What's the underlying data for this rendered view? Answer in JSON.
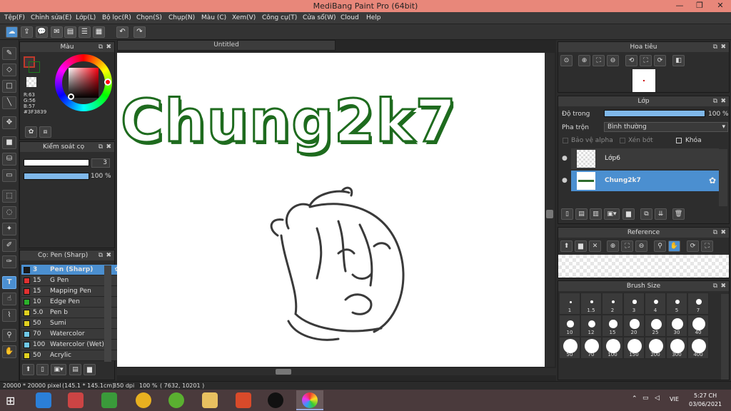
{
  "window": {
    "title": "MediBang Paint Pro (64bit)"
  },
  "menu": [
    "Tệp(F)",
    "Chỉnh sửa(E)",
    "Lớp(L)",
    "Bộ lọc(R)",
    "Chọn(S)",
    "Chụp(N)",
    "Màu (C)",
    "Xem(V)",
    "Công cụ(T)",
    "Cửa sổ(W)",
    "Cloud",
    "Help"
  ],
  "color_panel": {
    "title": "Màu",
    "r": "R:63",
    "g": "G:56",
    "b": "B:57",
    "hex": "#3F3839",
    "fg_color": "#3f3839",
    "accent": "#c0392b"
  },
  "brush_control": {
    "title": "Kiểm soát cọ",
    "size": "3",
    "opacity": "100 %",
    "opacity_fraction": 1.0
  },
  "brush_list": {
    "title": "Cọ: Pen (Sharp)",
    "items": [
      {
        "size": "3",
        "name": "Pen (Sharp)",
        "color": "#1a1a1a",
        "selected": true
      },
      {
        "size": "15",
        "name": "G Pen",
        "color": "#e03030"
      },
      {
        "size": "15",
        "name": "Mapping Pen",
        "color": "#e03030"
      },
      {
        "size": "10",
        "name": "Edge Pen",
        "color": "#2bb02b"
      },
      {
        "size": "5.0",
        "name": " Pen b",
        "color": "#e0d020"
      },
      {
        "size": "50",
        "name": "Sumi",
        "color": "#e0d020"
      },
      {
        "size": "70",
        "name": "Watercolor",
        "color": "#6fc8e8"
      },
      {
        "size": "100",
        "name": "Watercolor (Wet)",
        "color": "#6fc8e8"
      },
      {
        "size": "50",
        "name": "Acrylic",
        "color": "#e0d020"
      }
    ]
  },
  "canvas": {
    "tab_title": "Untitled",
    "big_text": "Chung2k7",
    "text_color": "#1e6b1e"
  },
  "navigator": {
    "title": "Hoa tiêu"
  },
  "layers": {
    "title": "Lớp",
    "opacity_label": "Độ trong",
    "opacity_value": "100 %",
    "opacity_fraction": 1.0,
    "blend_label": "Pha trộn",
    "blend_value": "Bình thường",
    "protect_alpha": "Bảo vệ alpha",
    "clipping": "Xén bớt",
    "lock": "Khóa",
    "items": [
      {
        "name": "Lớp6",
        "selected": false
      },
      {
        "name": "Chung2k7",
        "selected": true
      }
    ]
  },
  "reference": {
    "title": "Reference"
  },
  "brush_size": {
    "title": "Brush Size",
    "sizes": [
      "1",
      "1.5",
      "2",
      "3",
      "4",
      "5",
      "7",
      "10",
      "12",
      "15",
      "20",
      "25",
      "30",
      "40",
      "50",
      "70",
      "100",
      "150",
      "200",
      "300",
      "400"
    ]
  },
  "status": {
    "dims": "20000 * 20000 pixel",
    "cm": "(145.1 * 145.1cm)",
    "dpi": "350 dpi",
    "zoom": "100 %",
    "coords": "( 7632, 10201 )"
  },
  "taskbar": {
    "lang": "VIE",
    "time": "5:27 CH",
    "date": "03/06/2021"
  }
}
